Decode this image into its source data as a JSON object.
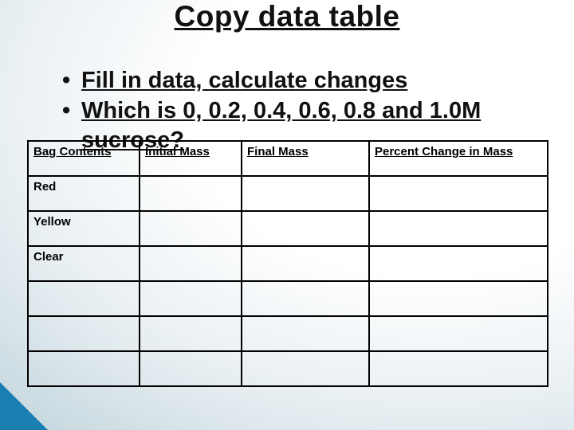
{
  "title": "Copy data table",
  "bullets": [
    "Fill in data, calculate changes",
    "Which is 0, 0.2, 0.4, 0.6, 0.8 and 1.0M sucrose?"
  ],
  "table": {
    "headers": [
      "Bag Contents",
      "Initial Mass",
      "Final Mass",
      "Percent Change in Mass"
    ],
    "rows": [
      {
        "label": "Red",
        "initial": "",
        "final": "",
        "pct": ""
      },
      {
        "label": "Yellow",
        "initial": "",
        "final": "",
        "pct": ""
      },
      {
        "label": "Clear",
        "initial": "",
        "final": "",
        "pct": ""
      },
      {
        "label": "",
        "initial": "",
        "final": "",
        "pct": ""
      },
      {
        "label": "",
        "initial": "",
        "final": "",
        "pct": ""
      },
      {
        "label": "",
        "initial": "",
        "final": "",
        "pct": ""
      }
    ]
  }
}
